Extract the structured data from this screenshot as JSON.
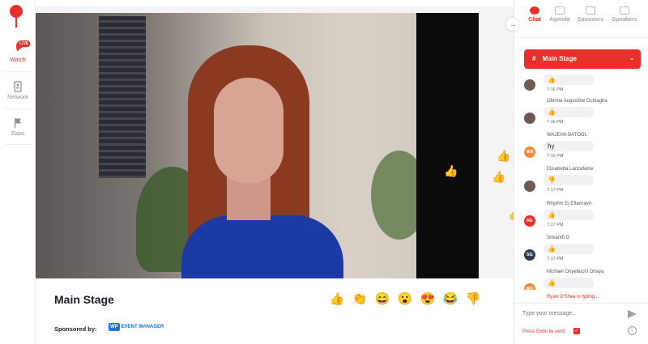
{
  "nav": {
    "items": [
      {
        "label": "Watch",
        "icon": "play-circle-icon",
        "active": true
      },
      {
        "label": "Network",
        "icon": "contact-card-icon"
      },
      {
        "label": "Expo",
        "icon": "flag-icon"
      }
    ],
    "live_badge": "LIVE"
  },
  "stage": {
    "title": "Main Stage",
    "sponsored_label": "Sponsored by:",
    "sponsor_mark": "WP",
    "sponsor_name": "EVENT MANAGER",
    "reactions": [
      "👍",
      "👏",
      "😄",
      "😮",
      "😍",
      "😂",
      "👎"
    ]
  },
  "floating_emojis": [
    "👍",
    "👍",
    "👍",
    "👍"
  ],
  "panel": {
    "tabs": [
      "Chat",
      "Agenda",
      "Sponsors",
      "Speakers"
    ],
    "active_tab": "Chat",
    "room": {
      "hash": "#",
      "name": "Main Stage"
    },
    "messages": [
      {
        "name": "",
        "text": "👍",
        "time": "7:16 PM",
        "initials": ""
      },
      {
        "name": "Obinna Augustine Ochiagha",
        "text": "👍",
        "time": "7:16 PM",
        "initials": ""
      },
      {
        "name": "WAJEHA BATOOL",
        "text": "hy",
        "time": "7:16 PM",
        "initials": "WB",
        "color": "#f08a3c"
      },
      {
        "name": "Elisabetta Lanzafame",
        "text": "👎",
        "time": "7:17 PM",
        "initials": ""
      },
      {
        "name": "Rhythm Ej Efternavn",
        "text": "👍",
        "time": "7:17 PM",
        "initials": "RE",
        "color": "#e8302a"
      },
      {
        "name": "Srikanth G",
        "text": "👍",
        "time": "7:17 PM",
        "initials": "SG",
        "color": "#2f3c52"
      },
      {
        "name": "Michael Onyebuchi Ohaya",
        "text": "👍",
        "time": "",
        "initials": "MO",
        "color": "#f08a3c"
      }
    ],
    "typing_text": "Ryan O'Shea is typing...",
    "input_placeholder": "Type your message...",
    "enter_label": "Press Enter to send",
    "accent": "#e8302a"
  }
}
